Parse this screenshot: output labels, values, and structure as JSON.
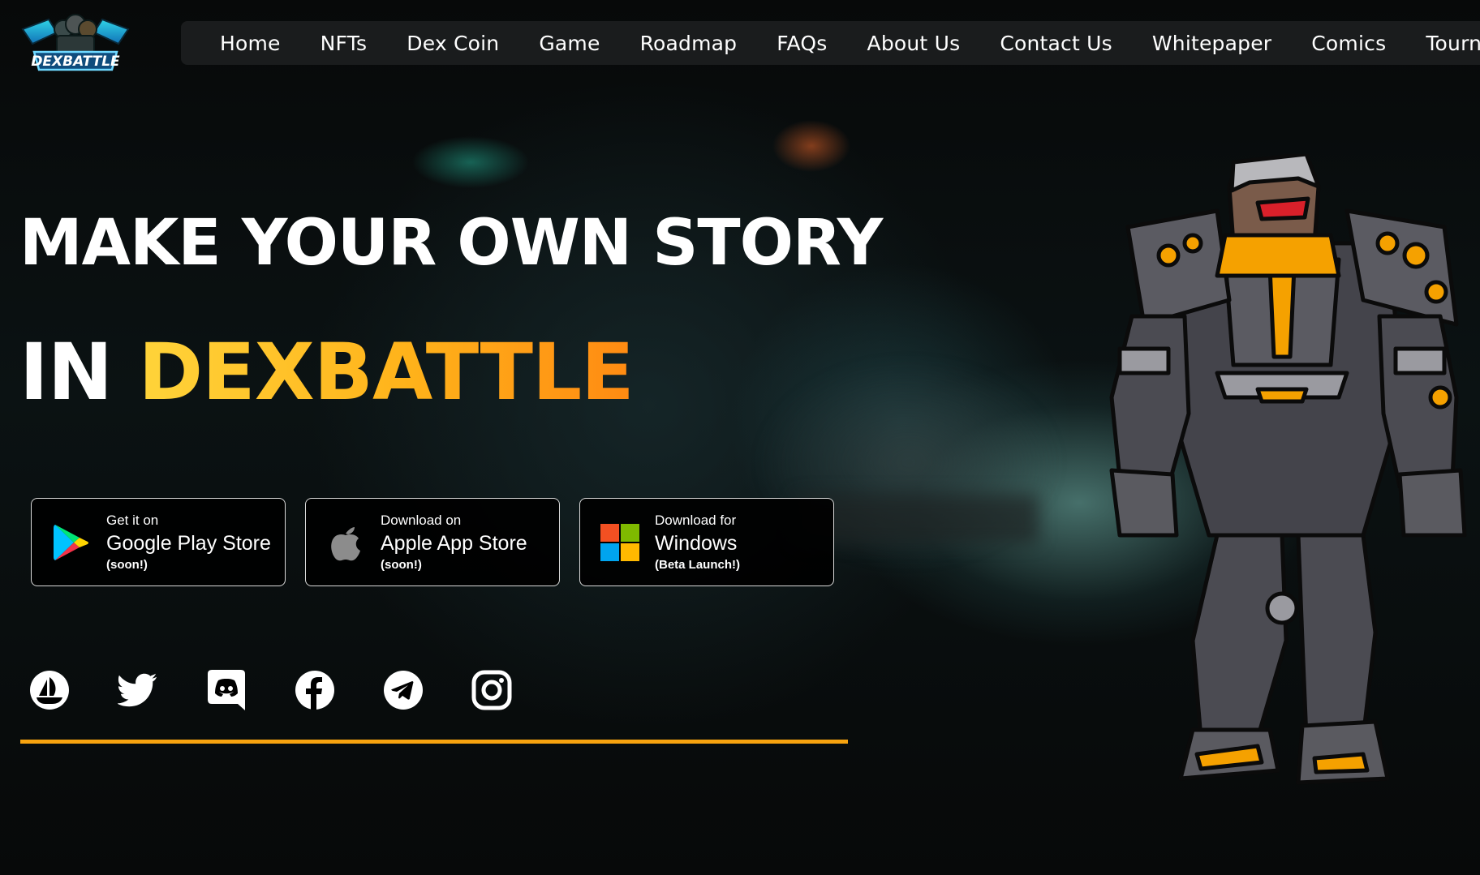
{
  "brand": {
    "logo_text": "DEXBATTLE"
  },
  "nav": {
    "items": [
      "Home",
      "NFTs",
      "Dex Coin",
      "Game",
      "Roadmap",
      "FAQs",
      "About Us",
      "Contact Us",
      "Whitepaper",
      "Comics",
      "Tournam"
    ]
  },
  "hero": {
    "line1": "MAKE YOUR OWN STORY",
    "line2_prefix": "IN ",
    "line2_accent": "DEXBATTLE"
  },
  "stores": [
    {
      "icon": "google-play-icon",
      "top": "Get it on",
      "main": "Google Play Store",
      "note": "(soon!)"
    },
    {
      "icon": "apple-icon",
      "top": "Download on",
      "main": "Apple App Store",
      "note": "(soon!)"
    },
    {
      "icon": "windows-icon",
      "top": "Download for",
      "main": "Windows",
      "note": "(Beta Launch!)"
    }
  ],
  "socials": [
    "opensea-icon",
    "twitter-icon",
    "discord-icon",
    "facebook-icon",
    "telegram-icon",
    "instagram-icon"
  ],
  "colors": {
    "accent": "#f7a30f",
    "accent_gradient_start": "#ffd43a",
    "accent_gradient_end": "#ff8a12",
    "nav_bg": "#1a1c1d",
    "page_bg": "#050707"
  }
}
